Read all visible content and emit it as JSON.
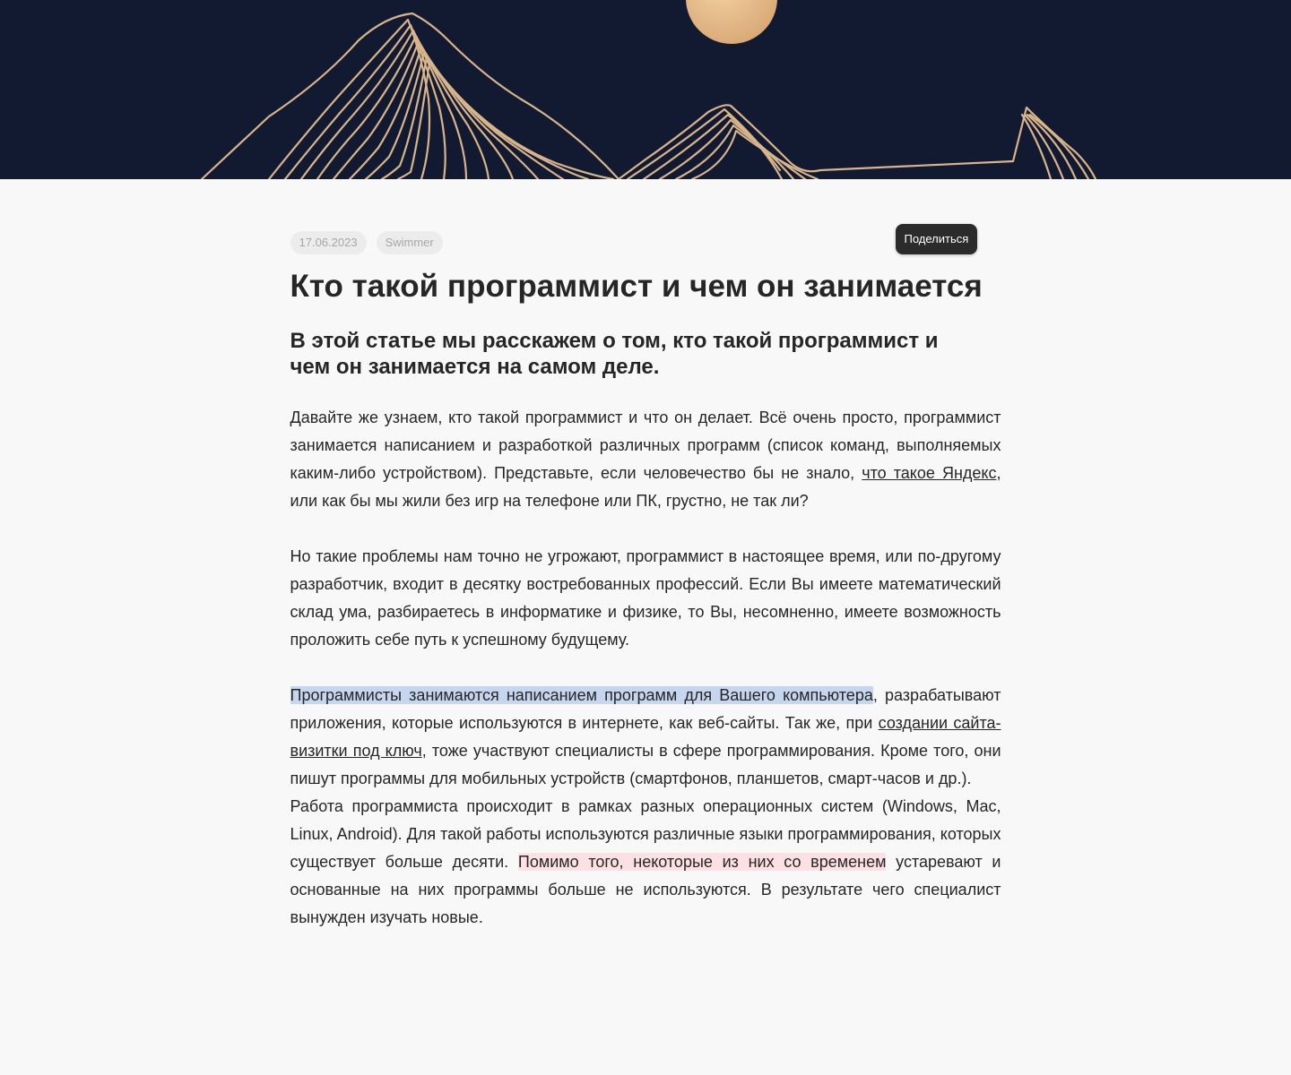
{
  "hero": {
    "image": "mountains-moon-illustration"
  },
  "meta": {
    "date": "17.06.2023",
    "author": "Swimmer"
  },
  "share_label": "Поделиться",
  "title": "Кто такой программист и чем он занимается",
  "subtitle": "В этой статье мы расскажем о том, кто такой программист и чем он занимается на самом деле.",
  "p1": {
    "before": "Давайте же узнаем, кто такой программист и что он делает. Всё очень просто, программист занимается написанием и разработкой различных программ (список команд, выполняемых каким-либо устройством). Представьте, если человечество бы не знало, ",
    "link": "что такое Яндекс",
    "after": ", или как бы мы жили без игр на телефоне или ПК, грустно, не так ли?"
  },
  "p2": "Но такие проблемы нам точно не угрожают, программист в настоящее время, или по-другому разработчик, входит в десятку востребованных профессий. Если Вы имеете математический склад ума, разбираетесь в информатике и физике, то Вы, несомненно, имеете возможность проложить себе путь к успешному будущему.",
  "p3": {
    "highlight": "Программисты занимаются написанием программ для Вашего компьютера",
    "middle": ", разрабатывают приложения, которые используются в интернете, как веб-сайты. Так же, при ",
    "link": "создании сайта-визитки под ключ",
    "after": ", тоже участвуют специалисты в сфере программирования. Кроме того, они пишут программы для мобильных устройств (смартфонов, планшетов, смарт-часов и др.)."
  },
  "p4": {
    "before": "Работа программиста происходит в рамках разных операционных систем (Windows, Mac, Linux, Android). Для такой работы используются различные языки программирования, которых существует больше десяти. ",
    "highlight": "Помимо того, некоторые из них со временем",
    "after": " устаревают и основанные на них программы больше не используются. В результате чего специалист вынужден изучать новые."
  },
  "colors": {
    "hero_bg": "#121a31",
    "moon": "#e3b98a",
    "line_gold": "#d8b48a",
    "highlight_blue": "#c5d6ee",
    "highlight_pink": "#fbe0e4",
    "page_bg": "#f8f8f8",
    "text": "#262626"
  }
}
